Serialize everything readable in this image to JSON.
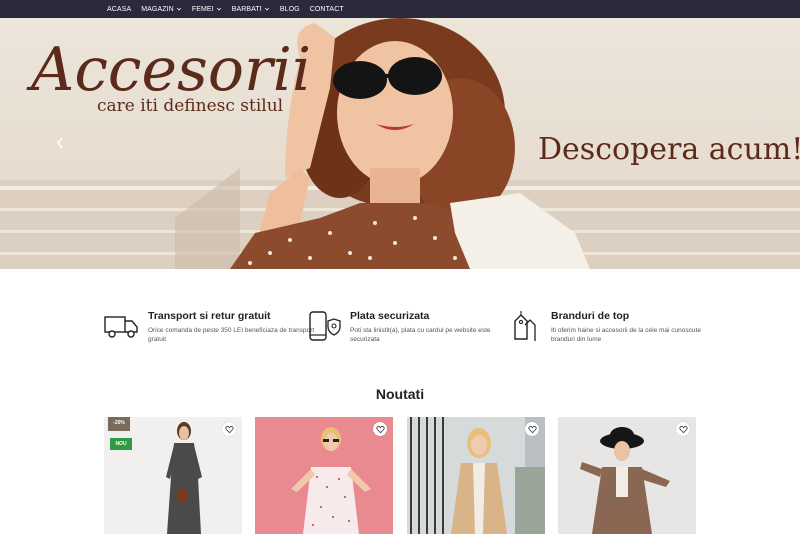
{
  "nav": {
    "items": [
      {
        "label": "ACASA",
        "has_dropdown": false
      },
      {
        "label": "MAGAZIN",
        "has_dropdown": true
      },
      {
        "label": "FEMEI",
        "has_dropdown": true
      },
      {
        "label": "BARBATI",
        "has_dropdown": true
      },
      {
        "label": "BLOG",
        "has_dropdown": false
      },
      {
        "label": "CONTACT",
        "has_dropdown": false
      }
    ]
  },
  "hero": {
    "title": "Accesorii",
    "subtitle": "care iti definesc stilul",
    "cta": "Descopera acum!",
    "text_color": "#5b2a1b"
  },
  "features": [
    {
      "icon": "truck-icon",
      "title": "Transport si retur gratuit",
      "desc": "Orice comanda de peste 350 LEI beneficiaza de transport gratuit"
    },
    {
      "icon": "secure-payment-icon",
      "title": "Plata securizata",
      "desc": "Poti sta linistit(a), plata cu cardul pe website este securizata"
    },
    {
      "icon": "price-tags-icon",
      "title": "Branduri de top",
      "desc": "Iti oferim haine si accesorii de la cele mai cunoscute branduri din lume"
    }
  ],
  "products_section": {
    "title": "Noutati",
    "products": [
      {
        "image": "woman-grey-dress",
        "discount_badge": "-20%",
        "new_badge": "NOU"
      },
      {
        "image": "woman-floral-dress-pink-background"
      },
      {
        "image": "woman-beige-trench-coat"
      },
      {
        "image": "woman-black-hat-brown-coat"
      }
    ]
  },
  "colors": {
    "nav_bg": "#2a2a3c",
    "accent_brown": "#5b2a1b",
    "new_badge": "#2f9b44",
    "discount_badge": "#7a6a5a"
  }
}
